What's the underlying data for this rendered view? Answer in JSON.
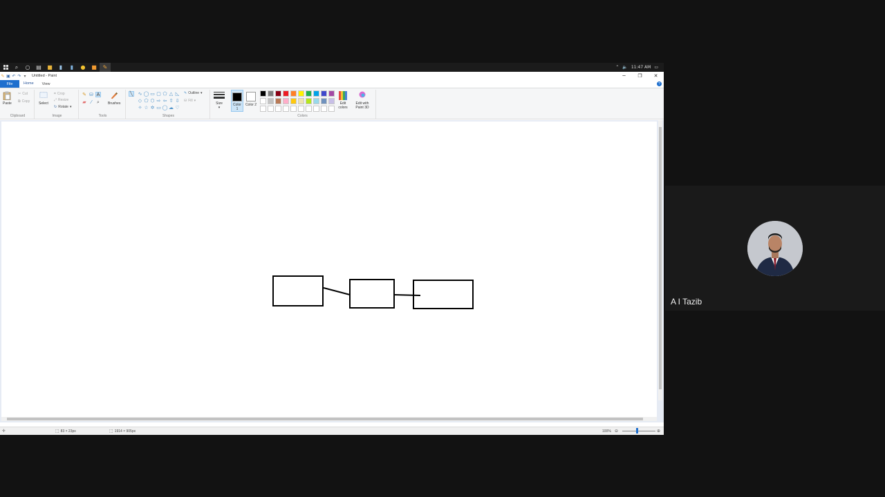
{
  "taskbar": {
    "time": "11:47 AM"
  },
  "window": {
    "title": "Untitled - Paint",
    "min": "─",
    "restore": "❐",
    "close": "✕"
  },
  "ribbon": {
    "tabs": {
      "file": "File",
      "home": "Home",
      "view": "View"
    },
    "clipboard": {
      "paste": "Paste",
      "cut": "Cut",
      "copy": "Copy",
      "group": "Clipboard"
    },
    "image": {
      "select": "Select",
      "crop": "Crop",
      "resize": "Resize",
      "rotate": "Rotate",
      "group": "Image"
    },
    "tools": {
      "brushes": "Brushes",
      "group": "Tools"
    },
    "shapes": {
      "outline": "Outline",
      "fill": "Fill",
      "group": "Shapes"
    },
    "size": {
      "label": "Size"
    },
    "colors": {
      "color1": "Color 1",
      "color2": "Color 2",
      "edit_colors": "Edit colors",
      "edit_3d": "Edit with Paint 3D",
      "group": "Colors",
      "palette": [
        "#000000",
        "#7f7f7f",
        "#880015",
        "#ed1c24",
        "#ff7f27",
        "#fff200",
        "#22b14c",
        "#00a2e8",
        "#3f48cc",
        "#a349a4",
        "#ffffff",
        "#c3c3c3",
        "#b97a57",
        "#ffaec9",
        "#ffc90e",
        "#efe4b0",
        "#b5e61d",
        "#99d9ea",
        "#7092be",
        "#c8bfe7",
        "#ffffff",
        "#ffffff",
        "#ffffff",
        "#ffffff",
        "#ffffff",
        "#ffffff",
        "#ffffff",
        "#ffffff",
        "#ffffff",
        "#ffffff"
      ]
    }
  },
  "status": {
    "selection_size": "83 × 23px",
    "canvas_size": "1914 × 905px",
    "zoom": "100%"
  },
  "participant": {
    "name": "A I Tazib"
  }
}
